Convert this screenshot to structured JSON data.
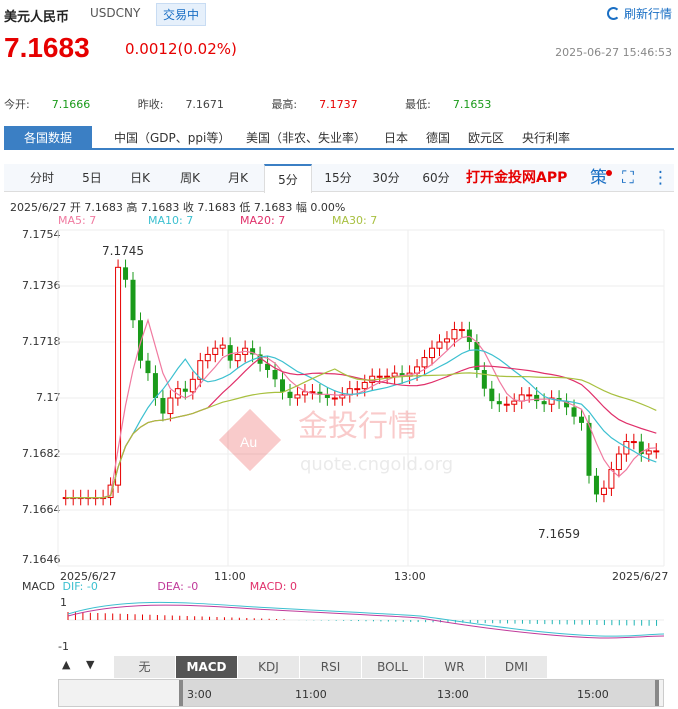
{
  "header": {
    "title": "美元人民币",
    "code": "USDCNY",
    "status": "交易中",
    "refresh": "刷新行情",
    "price": "7.1683",
    "change": "0.0012(0.02%)",
    "timestamp": "2025-06-27 15:46:53"
  },
  "stats": {
    "open_label": "今开:",
    "open": "7.1666",
    "prev_label": "昨收:",
    "prev": "7.1671",
    "high_label": "最高:",
    "high": "7.1737",
    "low_label": "最低:",
    "low": "7.1653"
  },
  "tabs1": [
    "各国数据",
    "中国（GDP、ppi等）",
    "美国（非农、失业率）",
    "日本",
    "德国",
    "欧元区",
    "央行利率"
  ],
  "tabs2": [
    "分时",
    "5日",
    "日K",
    "周K",
    "月K",
    "5分",
    "15分",
    "30分",
    "60分"
  ],
  "promo": "打开金投网APP",
  "ce_label": "策",
  "ohlc": "2025/6/27  开 7.1683  高 7.1683  收 7.1683  低 7.1683  幅 0.00%",
  "ma": {
    "ma5": "MA5: 7",
    "ma10": "MA10: 7",
    "ma20": "MA20: 7",
    "ma30": "MA30: 7"
  },
  "colors": {
    "up": "#e60000",
    "down": "#1a9a1a",
    "ma5": "#f07aa0",
    "ma10": "#3cc0d0",
    "ma20": "#e0306a",
    "ma30": "#a8c040"
  },
  "yaxis": [
    "7.1754",
    "7.1736",
    "7.1718",
    "7.17",
    "7.1682",
    "7.1664",
    "7.1646"
  ],
  "xaxis": {
    "start": "2025/6/27",
    "t1": "11:00",
    "t2": "13:00",
    "end": "2025/6/27"
  },
  "annot": {
    "high": "7.1745",
    "low": "7.1659"
  },
  "watermark": {
    "brand": "金投行情",
    "url": "quote.cngold.org"
  },
  "macd": {
    "label": "MACD",
    "dif": "DIF: -0",
    "dea": "DEA: -0",
    "macd": "MACD: 0",
    "y1": "1",
    "ym1": "-1"
  },
  "indicators": [
    "无",
    "MACD",
    "KDJ",
    "RSI",
    "BOLL",
    "WR",
    "DMI"
  ],
  "nav": {
    "t1": "3:00",
    "t2": "11:00",
    "t3": "13:00",
    "t4": "15:00"
  },
  "chart_data": {
    "type": "candlestick",
    "ylim": [
      7.1646,
      7.1754
    ],
    "values": [
      7.1668,
      7.1668,
      7.1668,
      7.1668,
      7.1668,
      7.1668,
      7.1672,
      7.1742,
      7.1738,
      7.1725,
      7.1712,
      7.1708,
      7.17,
      7.1695,
      7.17,
      7.1703,
      7.1702,
      7.1706,
      7.1712,
      7.1714,
      7.1716,
      7.1717,
      7.1712,
      7.1714,
      7.1716,
      7.1714,
      7.1711,
      7.1709,
      7.1706,
      7.1702,
      7.17,
      7.1701,
      7.1702,
      7.1702,
      7.1701,
      7.17,
      7.17,
      7.1701,
      7.1703,
      7.1703,
      7.1705,
      7.1707,
      7.1707,
      7.1707,
      7.1708,
      7.1707,
      7.1708,
      7.171,
      7.1713,
      7.1716,
      7.1718,
      7.1719,
      7.1722,
      7.1722,
      7.1718,
      7.1709,
      7.1703,
      7.1699,
      7.1698,
      7.1698,
      7.1699,
      7.1701,
      7.1701,
      7.1699,
      7.1698,
      7.17,
      7.1699,
      7.1697,
      7.1694,
      7.1692,
      7.1675,
      7.1669,
      7.1671,
      7.1677,
      7.1682,
      7.1686,
      7.1686,
      7.1682,
      7.1683,
      7.1683
    ]
  }
}
